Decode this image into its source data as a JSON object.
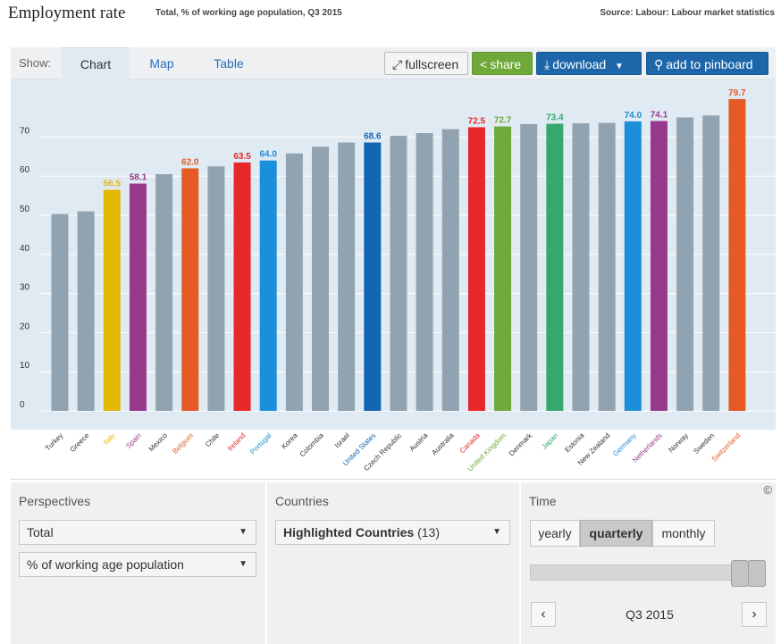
{
  "header": {
    "title": "Employment rate",
    "subtitle": "Total, % of working age population, Q3 2015",
    "source": "Source: Labour: Labour market statistics"
  },
  "toolbar": {
    "show_label": "Show:",
    "tabs": [
      {
        "label": "Chart",
        "active": true
      },
      {
        "label": "Map",
        "active": false
      },
      {
        "label": "Table",
        "active": false
      }
    ],
    "fullscreen_label": "fullscreen",
    "share_label": "share",
    "download_label": "download",
    "pinboard_label": "add to pinboard"
  },
  "colors": {
    "default_bar": "#91a3b0",
    "plot_background": "#dfeaf2",
    "gridline": "#ffffff",
    "tick_text": "#333333"
  },
  "chart_data": {
    "type": "bar",
    "ylim": [
      0,
      80
    ],
    "yticks": [
      0,
      10,
      20,
      30,
      40,
      50,
      60,
      70
    ],
    "grid": true,
    "categories": [
      "Turkey",
      "Greece",
      "Italy",
      "Spain",
      "Mexico",
      "Belgium",
      "Chile",
      "Ireland",
      "Portugal",
      "Korea",
      "Colombia",
      "Israel",
      "United States",
      "Czech Republic",
      "Austria",
      "Australia",
      "Canada",
      "United Kingdom",
      "Denmark",
      "Japan",
      "Estonia",
      "New Zealand",
      "Germany",
      "Netherlands",
      "Norway",
      "Sweden",
      "Switzerland"
    ],
    "values": [
      50.3,
      51.0,
      56.5,
      58.1,
      60.5,
      62.0,
      62.5,
      63.5,
      64.0,
      65.8,
      67.5,
      68.6,
      68.6,
      70.3,
      71.0,
      72.0,
      72.5,
      72.7,
      73.3,
      73.4,
      73.5,
      73.6,
      74.0,
      74.1,
      75.0,
      75.5,
      79.7
    ],
    "data_labels": [
      "",
      "",
      "56.5",
      "58.1",
      "",
      "62.0",
      "",
      "63.5",
      "64.0",
      "",
      "",
      "",
      "68.6",
      "",
      "",
      "",
      "72.5",
      "72.7",
      "",
      "73.4",
      "",
      "",
      "74.0",
      "74.1",
      "",
      "",
      "79.7"
    ],
    "bar_colors": [
      "#91a3b0",
      "#91a3b0",
      "#e3b600",
      "#973a8e",
      "#91a3b0",
      "#e55a25",
      "#91a3b0",
      "#e6282b",
      "#1c8fdb",
      "#91a3b0",
      "#91a3b0",
      "#91a3b0",
      "#1366b0",
      "#91a3b0",
      "#91a3b0",
      "#91a3b0",
      "#e6282b",
      "#6ea93a",
      "#91a3b0",
      "#35a86d",
      "#91a3b0",
      "#91a3b0",
      "#1c8fdb",
      "#973a8e",
      "#91a3b0",
      "#91a3b0",
      "#e55a25"
    ],
    "label_colors": [
      "#333333",
      "#333333",
      "#e3b600",
      "#973a8e",
      "#333333",
      "#e55a25",
      "#333333",
      "#e6282b",
      "#1c8fdb",
      "#333333",
      "#333333",
      "#333333",
      "#1366b0",
      "#333333",
      "#333333",
      "#333333",
      "#e6282b",
      "#6ea93a",
      "#333333",
      "#35a86d",
      "#333333",
      "#333333",
      "#1c8fdb",
      "#973a8e",
      "#333333",
      "#333333",
      "#e55a25"
    ]
  },
  "controls": {
    "perspectives": {
      "title": "Perspectives",
      "select1": "Total",
      "select2": "% of working age population"
    },
    "countries": {
      "title": "Countries",
      "select_label": "Highlighted Countries",
      "select_count": "(13)"
    },
    "time": {
      "title": "Time",
      "options": [
        {
          "label": "yearly",
          "active": false
        },
        {
          "label": "quarterly",
          "active": true
        },
        {
          "label": "monthly",
          "active": false
        }
      ],
      "period": "Q3 2015",
      "prev": "‹",
      "next": "›",
      "copyright": "©"
    }
  }
}
